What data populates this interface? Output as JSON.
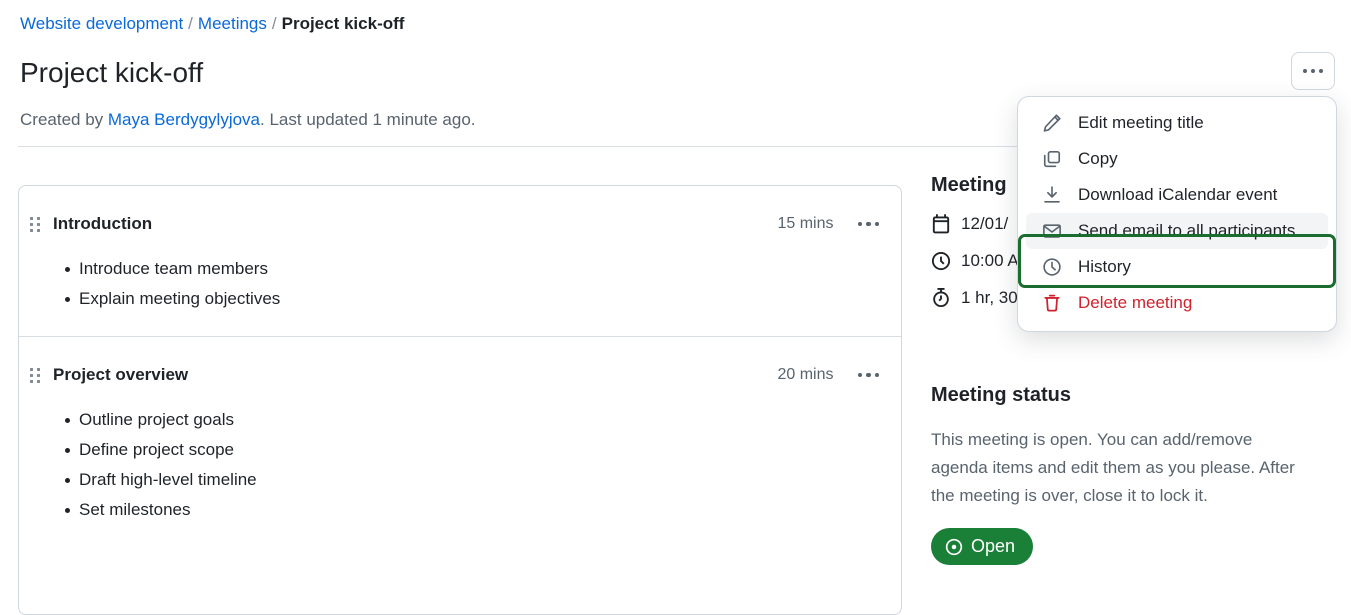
{
  "breadcrumb": {
    "items": [
      {
        "label": "Website development",
        "type": "link"
      },
      {
        "label": "Meetings",
        "type": "link"
      },
      {
        "label": "Project kick-off",
        "type": "current"
      }
    ],
    "separator": "/"
  },
  "header": {
    "title": "Project kick-off",
    "created_prefix": "Created by ",
    "author": "Maya Berdygylyjova",
    "updated_suffix": ". Last updated 1 minute ago."
  },
  "agenda": {
    "items": [
      {
        "title": "Introduction",
        "duration": "15 mins",
        "bullets": [
          "Introduce team members",
          "Explain meeting objectives"
        ]
      },
      {
        "title": "Project overview",
        "duration": "20 mins",
        "bullets": [
          "Outline project goals",
          "Define project scope",
          "Draft high-level timeline",
          "Set milestones"
        ]
      }
    ]
  },
  "meeting_details": {
    "heading": "Meeting",
    "date": "12/01/",
    "time": "10:00 A",
    "duration": "1 hr, 30"
  },
  "meeting_status": {
    "heading": "Meeting status",
    "description": "This meeting is open. You can add/remove agenda items and edit them as you please. After the meeting is over, close it to lock it.",
    "badge_label": "Open",
    "badge_color": "#1a7f37"
  },
  "menu": {
    "items": [
      {
        "label": "Edit meeting title",
        "icon": "pencil-icon",
        "danger": false,
        "highlighted": false
      },
      {
        "label": "Copy",
        "icon": "copy-icon",
        "danger": false,
        "highlighted": false
      },
      {
        "label": "Download iCalendar event",
        "icon": "download-icon",
        "danger": false,
        "highlighted": false
      },
      {
        "label": "Send email to all participants",
        "icon": "envelope-icon",
        "danger": false,
        "highlighted": true
      },
      {
        "label": "History",
        "icon": "clock-icon",
        "danger": false,
        "highlighted": false
      },
      {
        "label": "Delete meeting",
        "icon": "trash-icon",
        "danger": true,
        "highlighted": false
      }
    ],
    "highlight_color": "#1a6d2f",
    "danger_color": "#cf222e"
  },
  "colors": {
    "link": "#0969da",
    "text": "#1f2328",
    "muted": "#59636e",
    "border": "#d0d7de"
  }
}
